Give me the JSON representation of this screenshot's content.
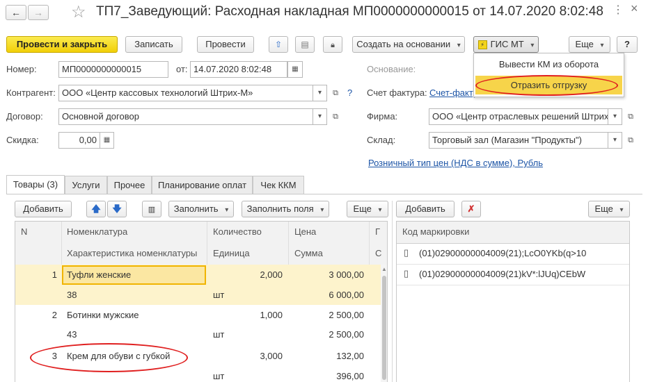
{
  "window": {
    "title": "ТП7_Заведующий: Расходная накладная МП0000000000015 от 14.07.2020 8:02:48"
  },
  "toolbar": {
    "post_close": "Провести и закрыть",
    "save": "Записать",
    "post": "Провести",
    "create_based": "Создать на основании",
    "gis_mt": "ГИС МТ",
    "more": "Еще",
    "help": "?"
  },
  "gis_menu": {
    "items": [
      "Вывести КМ из оборота",
      "Отразить отгрузку"
    ]
  },
  "form": {
    "number_label": "Номер:",
    "number": "МП0000000000015",
    "date_label": "от:",
    "date": "14.07.2020  8:02:48",
    "basis_label": "Основание:",
    "counterparty_label": "Контрагент:",
    "counterparty": "ООО «Центр кассовых технологий Штрих-М»",
    "help_q": "?",
    "invoice_label": "Счет фактура:",
    "invoice_link": "Счет-факту",
    "contract_label": "Договор:",
    "contract": "Основной договор",
    "firm_label": "Фирма:",
    "firm": "ООО «Центр отраслевых решений Штрих-",
    "discount_label": "Скидка:",
    "discount": "0,00",
    "warehouse_label": "Склад:",
    "warehouse": "Торговый зал (Магазин \"Продукты\")",
    "price_type_link": "Розничный тип цен (НДС в сумме), Рубль"
  },
  "tabs": [
    "Товары (3)",
    "Услуги",
    "Прочее",
    "Планирование оплат",
    "Чек ККМ"
  ],
  "goods_toolbar": {
    "add": "Добавить",
    "fill": "Заполнить",
    "fill_fields": "Заполнить поля",
    "more": "Еще"
  },
  "goods_table": {
    "headers": {
      "n": "N",
      "item": "Номенклатура",
      "qty": "Количество",
      "price": "Цена",
      "cut": "Г",
      "characteristic": "Характеристика номенклатуры",
      "unit": "Единица",
      "sum": "Сумма",
      "cut2": "С"
    },
    "rows": [
      {
        "n": "1",
        "item": "Туфли женские",
        "qty": "2,000",
        "price": "3 000,00",
        "characteristic": "38",
        "unit": "шт",
        "sum": "6 000,00"
      },
      {
        "n": "2",
        "item": "Ботинки мужские",
        "qty": "1,000",
        "price": "2 500,00",
        "characteristic": "43",
        "unit": "шт",
        "sum": "2 500,00"
      },
      {
        "n": "3",
        "item": "Крем для обуви с губкой",
        "qty": "3,000",
        "price": "132,00",
        "characteristic": "",
        "unit": "шт",
        "sum": "396,00"
      }
    ]
  },
  "marks_toolbar": {
    "add": "Добавить",
    "more": "Еще"
  },
  "marks_table": {
    "header": "Код маркировки",
    "rows": [
      "(01)02900000004009(21);LcO0YKb(q>10",
      "(01)02900000004009(21)kV*:lJUq)CEbW"
    ]
  },
  "colors": {
    "primary_button": "#f5d81b",
    "selected_row": "#fdf3cc",
    "menu_highlight": "#f7d44a",
    "annotation": "#e02020",
    "link": "#1c54a6"
  }
}
